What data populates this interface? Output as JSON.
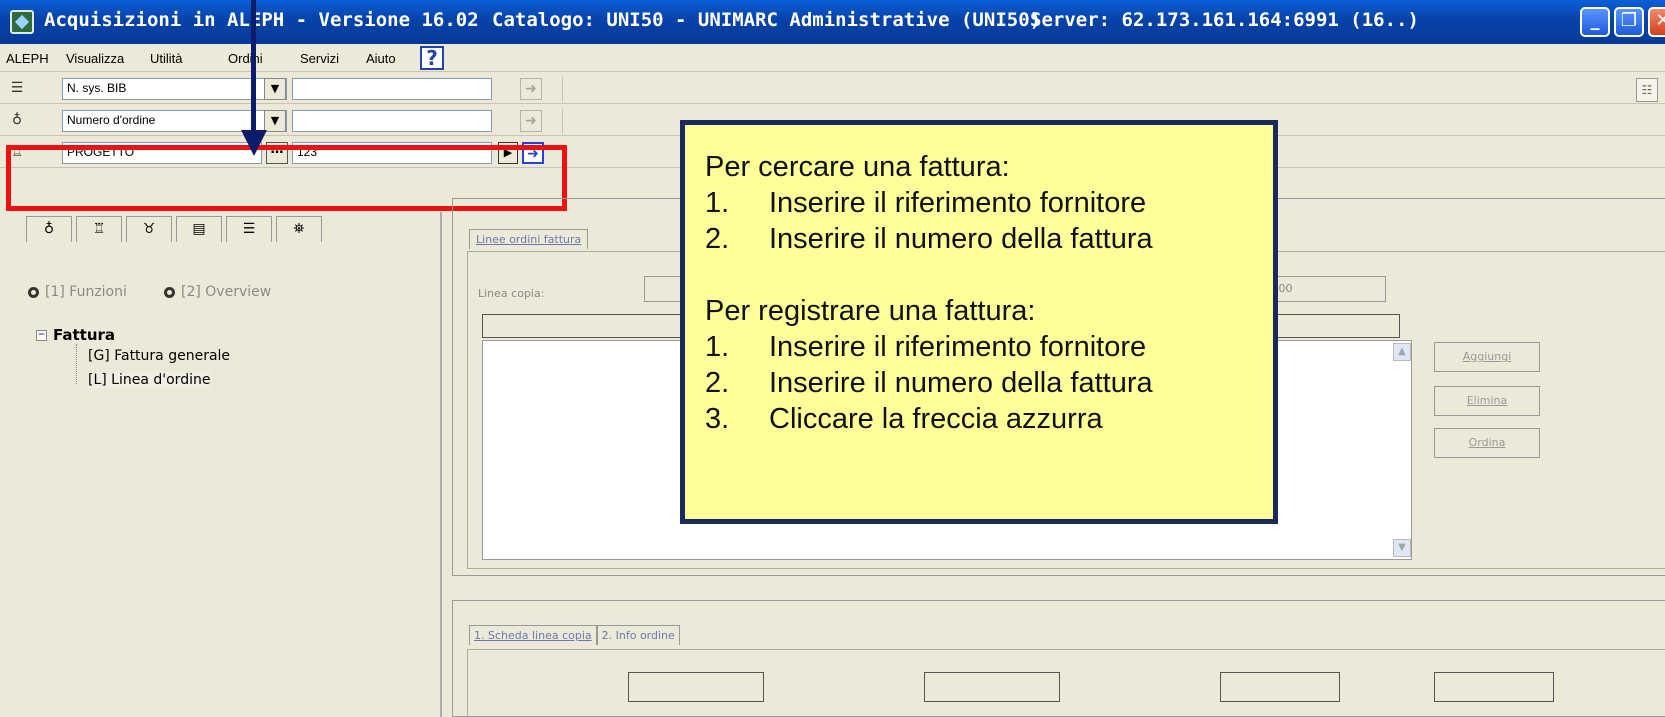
{
  "window": {
    "title_app": "Acquisizioni in ALEPH - Versione 16.02",
    "title_catalog": "Catalogo:  UNI50 - UNIMARC Administrative (UNI50)",
    "title_server": "Server:  62.173.161.164:6991 (16..)"
  },
  "menu": [
    "ALEPH",
    "Visualizza",
    "Utilità",
    "Ordini",
    "Servizi",
    "Aiuto"
  ],
  "search_rows": [
    {
      "field": "N. sys. BIB",
      "value": ""
    },
    {
      "field": "Numero d'ordine",
      "value": ""
    },
    {
      "field": "PROGETTO",
      "value": "123"
    }
  ],
  "left_panel": {
    "radio_funzioni": "[1] Funzioni",
    "radio_overview": "[2] Overview",
    "tree_root": "Fattura",
    "tree_items": [
      "[G] Fattura generale",
      "[L] Linea d'ordine"
    ]
  },
  "upper_pane": {
    "tab": "Linee ordini fattura",
    "label_copia": "Linea copia:",
    "field2_value": ".00",
    "buttons": [
      "Aggiungi",
      "Elimina",
      "Ordina"
    ]
  },
  "lower_pane": {
    "tabs": [
      "1. Scheda linea copia",
      "2. Info ordine"
    ]
  },
  "callout": {
    "search_title": "Per cercare una fattura:",
    "search_steps": [
      {
        "n": "1.",
        "text": "Inserire il riferimento fornitore"
      },
      {
        "n": "2.",
        "text": "Inserire il numero della fattura"
      }
    ],
    "register_title": "Per registrare una fattura:",
    "register_steps": [
      {
        "n": "1.",
        "text": "Inserire il riferimento fornitore"
      },
      {
        "n": "2.",
        "text": "Inserire il numero della fattura"
      },
      {
        "n": "3.",
        "text": "Cliccare la freccia azzurra"
      }
    ]
  },
  "colors": {
    "highlight_box": "#ee1111",
    "callout_bg": "#ffff99",
    "arrow": "#0d1b6b"
  }
}
